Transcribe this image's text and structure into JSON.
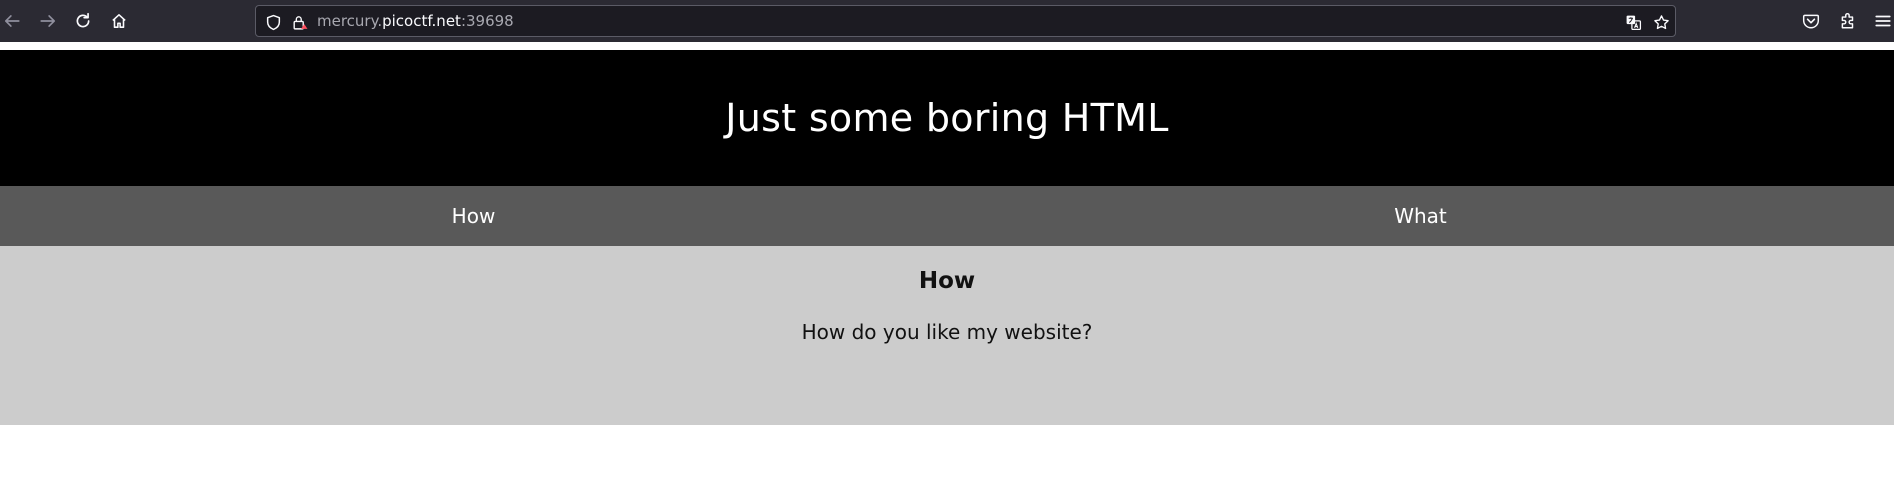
{
  "browser": {
    "url": {
      "subdomain": "mercury.",
      "domain": "picoctf.net",
      "port": ":39698"
    },
    "icons": {
      "back": "arrow-left-icon",
      "forward": "arrow-right-icon",
      "reload": "reload-icon",
      "home": "home-icon",
      "tracking_protection": "shield-icon",
      "site_security": "lock-warning-icon",
      "translate": "translate-icon",
      "bookmark": "star-icon",
      "pocket": "pocket-icon",
      "extensions": "puzzle-icon",
      "menu": "hamburger-menu-icon"
    },
    "colors": {
      "toolbar": "#2b2a33",
      "urlbar": "#1c1b22",
      "security_accent": "#ff4f5e"
    }
  },
  "page": {
    "header": {
      "title": "Just some boring HTML"
    },
    "tabs": [
      {
        "label": "How"
      },
      {
        "label": "What"
      }
    ],
    "content": {
      "heading": "How",
      "text": "How do you like my website?"
    },
    "colors": {
      "header_bg": "#000000",
      "tabbar_bg": "#595959",
      "content_bg": "#cccccc"
    }
  }
}
